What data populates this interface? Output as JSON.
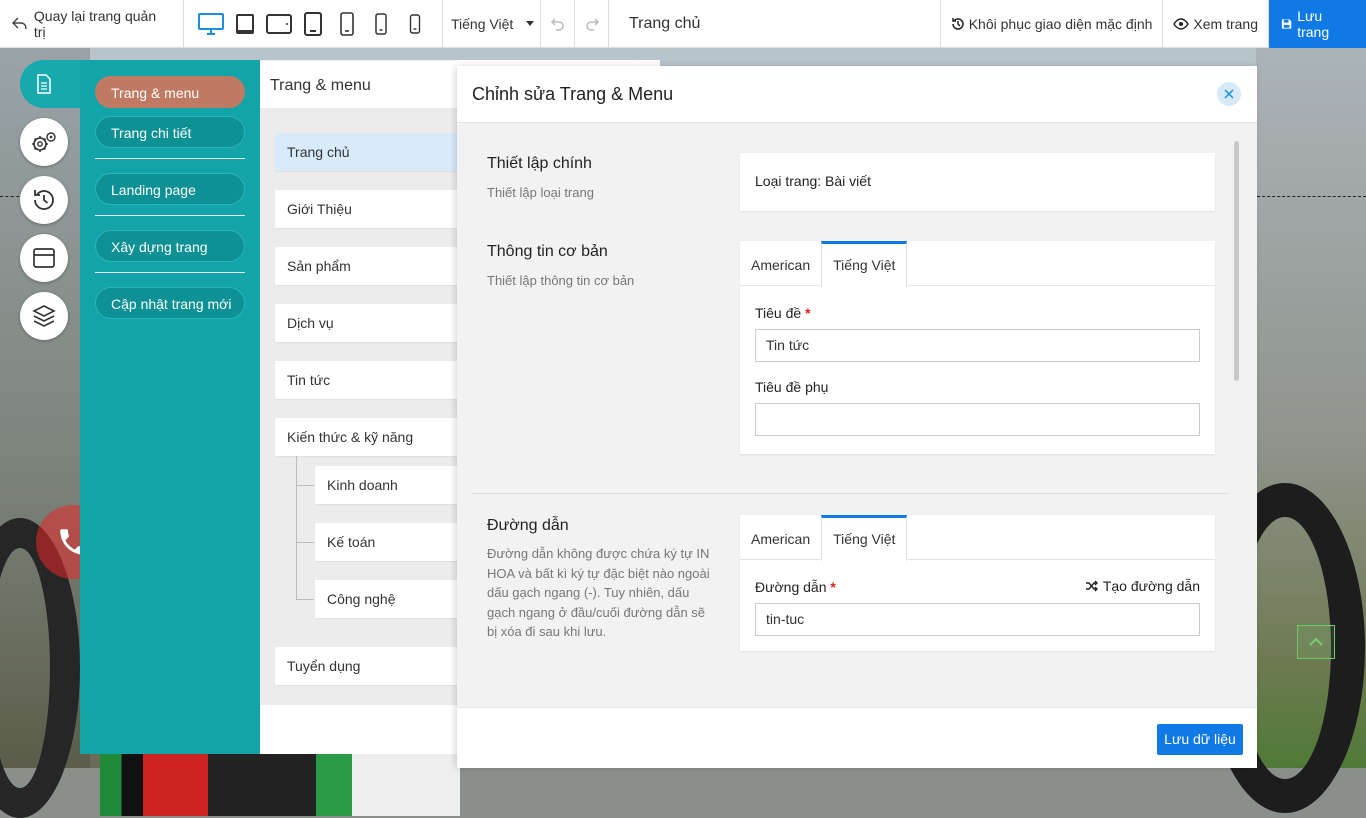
{
  "topbar": {
    "back_label": "Quay lại trang quản trị",
    "devices": [
      "desktop-icon",
      "tablet-landscape-icon",
      "tablet-wide-icon",
      "tablet-portrait-icon",
      "phone-large-icon",
      "phone-icon",
      "phone-small-icon"
    ],
    "language": "Tiếng Việt",
    "page_name": "Trang chủ",
    "restore_label": "Khôi phục giao diện mặc định",
    "view_label": "Xem trang",
    "save_label": "Lưu trang",
    "accent": "#0f7ae5"
  },
  "panel": {
    "items": [
      {
        "label": "Trang & menu"
      },
      {
        "label": "Trang chi tiết"
      },
      {
        "label": "Landing page"
      },
      {
        "label": "Xây dựng trang"
      },
      {
        "label": "Cập nhật trang mới"
      }
    ],
    "color": "#12a4a8",
    "active_color": "#c07a63"
  },
  "pages": {
    "title": "Trang & menu",
    "items": [
      {
        "label": "Trang chủ"
      },
      {
        "label": "Giới Thiệu"
      },
      {
        "label": "Sản phẩm"
      },
      {
        "label": "Dịch vụ"
      },
      {
        "label": "Tin tức"
      },
      {
        "label": "Kiến thức & kỹ năng"
      },
      {
        "label": "Kinh doanh"
      },
      {
        "label": "Kế toán"
      },
      {
        "label": "Công nghệ"
      },
      {
        "label": "Tuyển dụng"
      }
    ]
  },
  "modal": {
    "title": "Chỉnh sửa Trang & Menu",
    "main": {
      "title": "Thiết lập chính",
      "desc": "Thiết lập loại trang",
      "page_type": "Loại trang: Bài viết"
    },
    "basic": {
      "title": "Thông tin cơ bản",
      "desc": "Thiết lập thông tin cơ bản",
      "tabs": [
        "American",
        "Tiếng Việt"
      ],
      "title_label": "Tiêu đề",
      "title_value": "Tin tức",
      "subtitle_label": "Tiêu đề phụ",
      "subtitle_value": ""
    },
    "path": {
      "title": "Đường dẫn",
      "desc": "Đường dẫn không được chứa ký tự IN HOA và bất kì ký tự đặc biệt nào ngoài dấu gạch ngang (-). Tuy nhiên, dấu gạch ngang ở đầu/cuối đường dẫn sẽ bị xóa đi sau khi lưu.",
      "tabs": [
        "American",
        "Tiếng Việt"
      ],
      "path_label": "Đường dẫn",
      "generate_label": "Tạo đường dẫn",
      "path_value": "tin-tuc"
    },
    "required_mark": "*",
    "save_label": "Lưu dữ liệu"
  }
}
